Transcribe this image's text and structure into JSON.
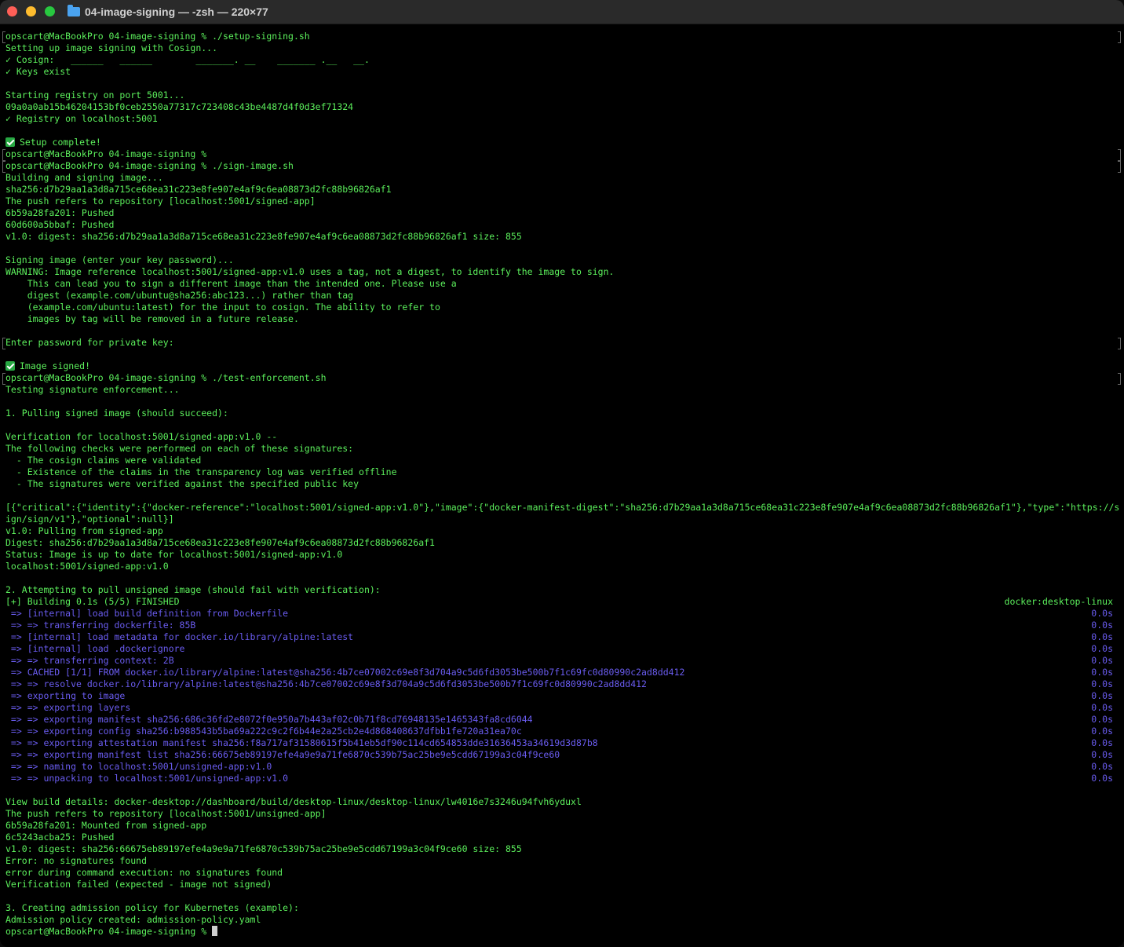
{
  "window": {
    "title": "04-image-signing — -zsh — 220×77"
  },
  "terminal": {
    "l01": "opscart@MacBookPro 04-image-signing % ./setup-signing.sh",
    "l02": "Setting up image signing with Cosign...",
    "l03": "✓ Cosign:   ______   ______        _______. __    _______ .__   __.",
    "l04": "✓ Keys exist",
    "l05": "",
    "l06": "Starting registry on port 5001...",
    "l07": "09a0a0ab15b46204153bf0ceb2550a77317c723408c43be4487d4f0d3ef71324",
    "l08": "✓ Registry on localhost:5001",
    "l09": "",
    "l10": "Setup complete!",
    "l11": "opscart@MacBookPro 04-image-signing %",
    "l12": "opscart@MacBookPro 04-image-signing % ./sign-image.sh",
    "l13": "Building and signing image...",
    "l14": "sha256:d7b29aa1a3d8a715ce68ea31c223e8fe907e4af9c6ea08873d2fc88b96826af1",
    "l15": "The push refers to repository [localhost:5001/signed-app]",
    "l16": "6b59a28fa201: Pushed",
    "l17": "60d600a5bbaf: Pushed",
    "l18": "v1.0: digest: sha256:d7b29aa1a3d8a715ce68ea31c223e8fe907e4af9c6ea08873d2fc88b96826af1 size: 855",
    "l19": "",
    "l20": "Signing image (enter your key password)...",
    "l21": "WARNING: Image reference localhost:5001/signed-app:v1.0 uses a tag, not a digest, to identify the image to sign.",
    "l22": "    This can lead you to sign a different image than the intended one. Please use a",
    "l23": "    digest (example.com/ubuntu@sha256:abc123...) rather than tag",
    "l24": "    (example.com/ubuntu:latest) for the input to cosign. The ability to refer to",
    "l25": "    images by tag will be removed in a future release.",
    "l26": "",
    "l27": "Enter password for private key:",
    "l28": "",
    "l29": "Image signed!",
    "l30": "opscart@MacBookPro 04-image-signing % ./test-enforcement.sh",
    "l31": "Testing signature enforcement...",
    "l32": "",
    "l33": "1. Pulling signed image (should succeed):",
    "l34": "",
    "l35": "Verification for localhost:5001/signed-app:v1.0 --",
    "l36": "The following checks were performed on each of these signatures:",
    "l37": "  - The cosign claims were validated",
    "l38": "  - Existence of the claims in the transparency log was verified offline",
    "l39": "  - The signatures were verified against the specified public key",
    "l40": "",
    "l41": "[{\"critical\":{\"identity\":{\"docker-reference\":\"localhost:5001/signed-app:v1.0\"},\"image\":{\"docker-manifest-digest\":\"sha256:d7b29aa1a3d8a715ce68ea31c223e8fe907e4af9c6ea08873d2fc88b96826af1\"},\"type\":\"https://sigstore.dev/cos",
    "l42": "ign/sign/v1\"},\"optional\":null}]",
    "l43": "v1.0: Pulling from signed-app",
    "l44": "Digest: sha256:d7b29aa1a3d8a715ce68ea31c223e8fe907e4af9c6ea08873d2fc88b96826af1",
    "l45": "Status: Image is up to date for localhost:5001/signed-app:v1.0",
    "l46": "localhost:5001/signed-app:v1.0",
    "l47": "",
    "l48": "2. Attempting to pull unsigned image (should fail with verification):",
    "l49": "[+] Building 0.1s (5/5) FINISHED",
    "l49r": "docker:desktop-linux",
    "l50": " => [internal] load build definition from Dockerfile",
    "l51": " => => transferring dockerfile: 85B",
    "l52": " => [internal] load metadata for docker.io/library/alpine:latest",
    "l53": " => [internal] load .dockerignore",
    "l54": " => => transferring context: 2B",
    "l55": " => CACHED [1/1] FROM docker.io/library/alpine:latest@sha256:4b7ce07002c69e8f3d704a9c5d6fd3053be500b7f1c69fc0d80990c2ad8dd412",
    "l56": " => => resolve docker.io/library/alpine:latest@sha256:4b7ce07002c69e8f3d704a9c5d6fd3053be500b7f1c69fc0d80990c2ad8dd412",
    "l57": " => exporting to image",
    "l58": " => => exporting layers",
    "l59": " => => exporting manifest sha256:686c36fd2e8072f0e950a7b443af02c0b71f8cd76948135e1465343fa8cd6044",
    "l60": " => => exporting config sha256:b988543b5ba69a222c9c2f6b44e2a25cb2e4d868408637dfbb1fe720a31ea70c",
    "l61": " => => exporting attestation manifest sha256:f8a717af31580615f5b41eb5df90c114cd654853dde31636453a34619d3d87b8",
    "l62": " => => exporting manifest list sha256:66675eb89197efe4a9e9a71fe6870c539b75ac25be9e5cdd67199a3c04f9ce60",
    "l63": " => => naming to localhost:5001/unsigned-app:v1.0",
    "l64": " => => unpacking to localhost:5001/unsigned-app:v1.0",
    "time": "0.0s",
    "l65": "",
    "l66": "View build details: docker-desktop://dashboard/build/desktop-linux/desktop-linux/lw4016e7s3246u94fvh6yduxl",
    "l67": "The push refers to repository [localhost:5001/unsigned-app]",
    "l68": "6b59a28fa201: Mounted from signed-app",
    "l69": "6c5243acba25: Pushed",
    "l70": "v1.0: digest: sha256:66675eb89197efe4a9e9a71fe6870c539b75ac25be9e5cdd67199a3c04f9ce60 size: 855",
    "l71": "Error: no signatures found",
    "l72": "error during command execution: no signatures found",
    "l73": "Verification failed (expected - image not signed)",
    "l74": "",
    "l75": "3. Creating admission policy for Kubernetes (example):",
    "l76": "Admission policy created: admission-policy.yaml",
    "l77": "opscart@MacBookPro 04-image-signing % "
  },
  "colors": {
    "output": "#5cf05c",
    "build": "#6a5cf0",
    "background": "#000000"
  }
}
